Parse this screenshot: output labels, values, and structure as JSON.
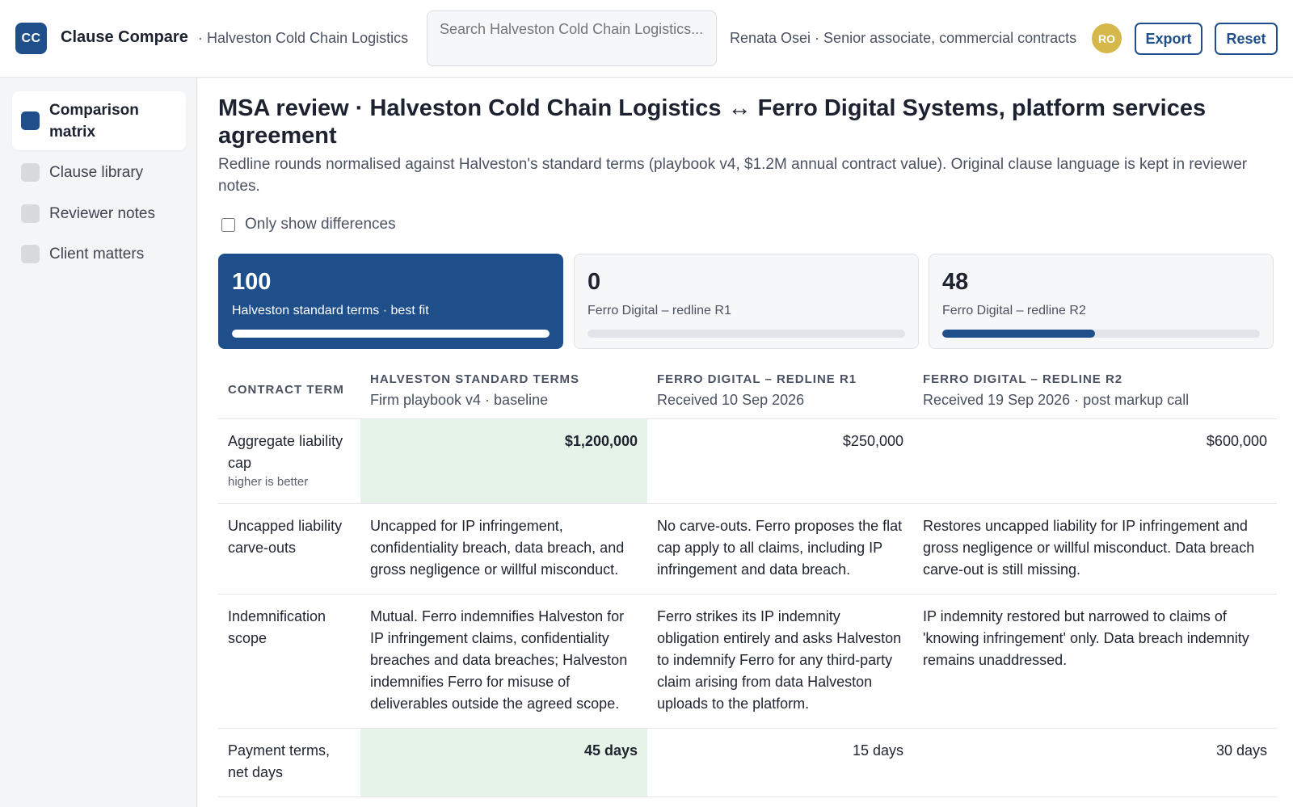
{
  "header": {
    "logo_text": "CC",
    "app_name": "Clause Compare",
    "org": "· Halveston Cold Chain Logistics",
    "search_placeholder": "Search Halveston Cold Chain Logistics...",
    "user": "Renata Osei · Senior associate, commercial contracts",
    "avatar_initials": "RO",
    "export_label": "Export",
    "reset_label": "Reset"
  },
  "sidebar": {
    "items": [
      {
        "label": "Comparison matrix",
        "active": true
      },
      {
        "label": "Clause library",
        "active": false
      },
      {
        "label": "Reviewer notes",
        "active": false
      },
      {
        "label": "Client matters",
        "active": false
      }
    ]
  },
  "main": {
    "title": "MSA review · Halveston Cold Chain Logistics ↔ Ferro Digital Systems, platform services agreement",
    "description": "Redline rounds normalised against Halveston's standard terms (playbook v4, $1.2M annual contract value). Original clause language is kept in reviewer notes.",
    "filter_label": "Only show differences",
    "scorecards": [
      {
        "value": "100",
        "label": "Halveston standard terms · best fit",
        "fill": 1.0
      },
      {
        "value": "0",
        "label": "Ferro Digital – redline R1",
        "fill": 0.0
      },
      {
        "value": "48",
        "label": "Ferro Digital – redline R2",
        "fill": 0.48
      }
    ],
    "table": {
      "term_header": "CONTRACT TERM",
      "columns": [
        {
          "title": "HALVESTON STANDARD TERMS",
          "sub": "Firm playbook v4 · baseline"
        },
        {
          "title": "FERRO DIGITAL – REDLINE R1",
          "sub": "Received 10 Sep 2026"
        },
        {
          "title": "FERRO DIGITAL – REDLINE R2",
          "sub": "Received 19 Sep 2026 · post markup call"
        }
      ],
      "rows": [
        {
          "term": "Aggregate liability cap",
          "hint": "higher is better",
          "values": [
            "$1,200,000",
            "$250,000",
            "$600,000"
          ]
        },
        {
          "term": "Uncapped liability carve-outs",
          "values": [
            "Uncapped for IP infringement, confidentiality breach, data breach, and gross negligence or willful misconduct.",
            "No carve-outs. Ferro proposes the flat cap apply to all claims, including IP infringement and data breach.",
            "Restores uncapped liability for IP infringement and gross negligence or willful misconduct. Data breach carve-out is still missing."
          ]
        },
        {
          "term": "Indemnification scope",
          "values": [
            "Mutual. Ferro indemnifies Halveston for IP infringement claims, confidentiality breaches and data breaches; Halveston indemnifies Ferro for misuse of deliverables outside the agreed scope.",
            "Ferro strikes its IP indemnity obligation entirely and asks Halveston to indemnify Ferro for any third-party claim arising from data Halveston uploads to the platform.",
            "IP indemnity restored but narrowed to claims of 'knowing infringement' only. Data breach indemnity remains unaddressed."
          ]
        },
        {
          "term": "Payment terms, net days",
          "values": [
            "45 days",
            "15 days",
            "30 days"
          ]
        }
      ]
    }
  },
  "colors": {
    "brand": "#1f4f8b",
    "best_cell": "#e5f3e8",
    "worse_text": "#c0392b",
    "avatar": "#d6b84a"
  }
}
